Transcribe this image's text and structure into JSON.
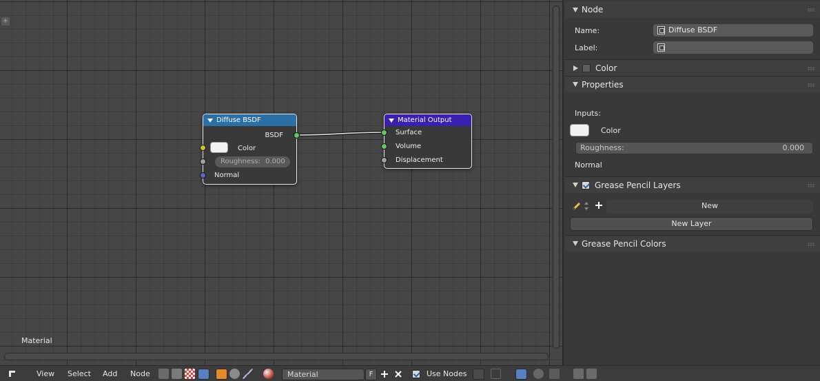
{
  "editor": {
    "corner_icon": "plus-icon",
    "material_label": "Material",
    "nodes": {
      "diffuse": {
        "title": "Diffuse BSDF",
        "header_color": "#2a6fa5",
        "output_socket": "BSDF",
        "color_input": "Color",
        "roughness_label": "Roughness:",
        "roughness_value": "0.000",
        "normal_input": "Normal"
      },
      "output": {
        "title": "Material Output",
        "header_color": "#3a1fb0",
        "surface_input": "Surface",
        "volume_input": "Volume",
        "displacement_input": "Displacement"
      }
    },
    "socket_colors": {
      "shader": "#63c763",
      "color": "#c7c729",
      "value": "#a1a1a1",
      "vector": "#6363c7"
    }
  },
  "panel": {
    "node_section": {
      "title": "Node",
      "name_label": "Name:",
      "name_value": "Diffuse BSDF",
      "label_label": "Label:",
      "label_value": ""
    },
    "color_section": {
      "title": "Color",
      "enabled": false
    },
    "properties_section": {
      "title": "Properties",
      "inputs_label": "Inputs:",
      "color_label": "Color",
      "roughness_label": "Roughness:",
      "roughness_value": "0.000",
      "normal_label": "Normal"
    },
    "grease_layers_section": {
      "title": "Grease Pencil Layers",
      "enabled": true,
      "new_button": "New",
      "new_layer_button": "New Layer"
    },
    "grease_colors_section": {
      "title": "Grease Pencil Colors"
    }
  },
  "header": {
    "menus": [
      "View",
      "Select",
      "Add",
      "Node"
    ],
    "material_field": "Material",
    "fake_user": "F",
    "use_nodes_label": "Use Nodes",
    "use_nodes_checked": true
  }
}
